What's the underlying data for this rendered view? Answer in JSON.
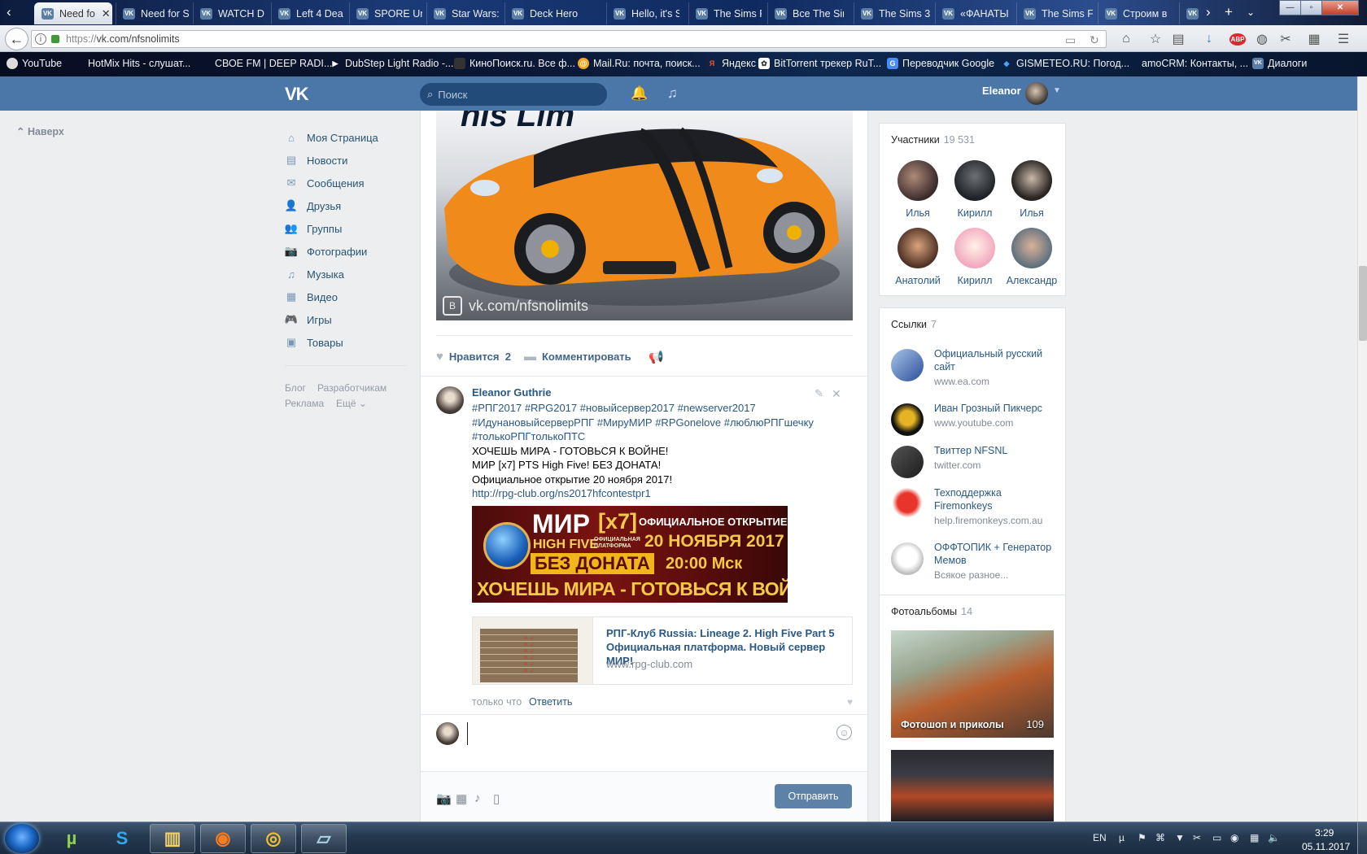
{
  "browser": {
    "tabs": [
      {
        "label": "Need fo",
        "active": true
      },
      {
        "label": "Need for S"
      },
      {
        "label": "WATCH D"
      },
      {
        "label": "Left 4 Dea"
      },
      {
        "label": "SPORE Uni"
      },
      {
        "label": "Star Wars:"
      },
      {
        "label": "Deck Hero"
      },
      {
        "label": "Hello, it's S"
      },
      {
        "label": "The Sims F"
      },
      {
        "label": "Все The Sir"
      },
      {
        "label": "The Sims 3"
      },
      {
        "label": "«ФАНАТЫ"
      },
      {
        "label": "The Sims F"
      },
      {
        "label": "Строим в"
      }
    ],
    "url": {
      "protocol": "https://",
      "host": "vk.com/nfsnolimits"
    },
    "bookmarks": [
      {
        "label": "YouTube"
      },
      {
        "label": "HotMix Hits - слушат..."
      },
      {
        "label": "СВОЕ FM | DEEP RADI..."
      },
      {
        "label": "DubStep Light Radio -..."
      },
      {
        "label": "КиноПоиск.ru. Все ф..."
      },
      {
        "label": "Mail.Ru: почта, поиск..."
      },
      {
        "label": "Яндекс"
      },
      {
        "label": "BitTorrent трекер RuT..."
      },
      {
        "label": "Переводчик Google"
      },
      {
        "label": "GISMETEO.RU: Погод..."
      },
      {
        "label": "amoCRM: Контакты, ..."
      },
      {
        "label": "Диалоги"
      }
    ]
  },
  "vk_header": {
    "logo": "VK",
    "search_placeholder": "Поиск",
    "user_name": "Eleanor"
  },
  "left": {
    "up_link": "Наверх",
    "menu": [
      {
        "label": "Моя Страница",
        "icon": "home-icon",
        "glyph": "⌂"
      },
      {
        "label": "Новости",
        "icon": "news-icon",
        "glyph": "▤"
      },
      {
        "label": "Сообщения",
        "icon": "messages-icon",
        "glyph": "✉"
      },
      {
        "label": "Друзья",
        "icon": "friends-icon",
        "glyph": "👤"
      },
      {
        "label": "Группы",
        "icon": "groups-icon",
        "glyph": "👥"
      },
      {
        "label": "Фотографии",
        "icon": "camera-icon",
        "glyph": "📷"
      },
      {
        "label": "Музыка",
        "icon": "music-icon",
        "glyph": "♫"
      },
      {
        "label": "Видео",
        "icon": "video-icon",
        "glyph": "▦"
      },
      {
        "label": "Игры",
        "icon": "games-icon",
        "glyph": "🎮"
      },
      {
        "label": "Товары",
        "icon": "bag-icon",
        "glyph": "▣"
      }
    ],
    "footer": {
      "blog": "Блог",
      "developers": "Разработчикам",
      "ads": "Реклама",
      "more": "Ещё"
    }
  },
  "post": {
    "image_watermark": "vk.com/nfsnolimits",
    "image_logo_fragment": "nis Lim",
    "like_label": "Нравится",
    "like_count": "2",
    "comment_label": "Комментировать"
  },
  "comment": {
    "author": "Eleanor Guthrie",
    "tags": "#РПГ2017 #RPG2017 #новыйсервер2017 #newserver2017 #ИдунановыйсерверРПГ #МируМИР #RPGonelove #люблюРПГшечку #толькоРПГтолькоПТС",
    "lines": [
      "ХОЧЕШЬ МИРА - ГОТОВЬСЯ К ВОЙНЕ!",
      "МИР [x7] PTS High Five! БЕЗ ДОНАТА!",
      "Официальное открытие 20 ноября 2017!"
    ],
    "link": "http://rpg-club.org/ns2017hfcontestpr1",
    "banner": {
      "mir": "МИР",
      "x7": "[x7]",
      "high_five": "HIGH FIVE",
      "platform": "ОФИЦИАЛЬНАЯ ПЛАТФОРМА",
      "no_donate": "БЕЗ ДОНАТА",
      "opening": "ОФИЦИАЛЬНОЕ ОТКРЫТИЕ",
      "date": "20 НОЯБРЯ 2017",
      "time": "20:00 Мск",
      "slogan": "ХОЧЕШЬ МИРА - ГОТОВЬСЯ К ВОЙНЕ"
    },
    "snippet": {
      "title": "РПГ-Клуб Russia: Lineage 2. High Five Part 5 Официальная платформа. Новый сервер МИР!",
      "domain": "www.rpg-club.com"
    },
    "time": "только что",
    "reply": "Ответить"
  },
  "compose": {
    "placeholder": "",
    "send_label": "Отправить"
  },
  "members": {
    "title": "Участники",
    "count": "19 531",
    "people": [
      {
        "name": "Илья"
      },
      {
        "name": "Кирилл"
      },
      {
        "name": "Илья"
      },
      {
        "name": "Анатолий"
      },
      {
        "name": "Кирилл"
      },
      {
        "name": "Александр"
      }
    ]
  },
  "links": {
    "title": "Ссылки",
    "count": "7",
    "items": [
      {
        "title": "Официальный русский сайт",
        "sub": "www.ea.com"
      },
      {
        "title": "Иван Грозный Пикчерс",
        "sub": "www.youtube.com"
      },
      {
        "title": "Твиттер NFSNL",
        "sub": "twitter.com"
      },
      {
        "title": "Техподдержка Firemonkeys",
        "sub": "help.firemonkeys.com.au"
      },
      {
        "title": "ОФФТОПИК + Генератор Мемов",
        "sub": "Всякое разное..."
      }
    ]
  },
  "albums": {
    "title": "Фотоальбомы",
    "count": "14",
    "items": [
      {
        "label": "Фотошоп и приколы",
        "count": "109"
      }
    ]
  },
  "taskbar": {
    "lang": "EN",
    "time": "3:29",
    "date": "05.11.2017"
  }
}
